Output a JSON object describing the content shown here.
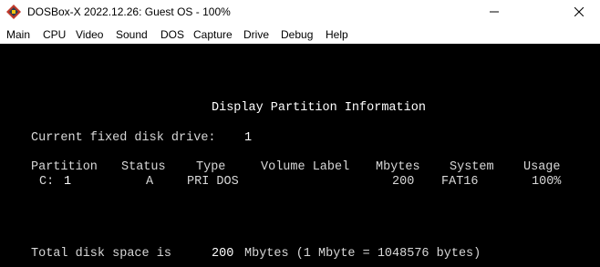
{
  "window": {
    "title": "DOSBox-X 2022.12.26: Guest OS - 100%"
  },
  "menu": [
    {
      "label": "Main"
    },
    {
      "label": "CPU"
    },
    {
      "label": "Video"
    },
    {
      "label": "Sound"
    },
    {
      "label": "DOS"
    },
    {
      "label": "Capture"
    },
    {
      "label": "Drive"
    },
    {
      "label": "Debug"
    },
    {
      "label": "Help"
    }
  ],
  "dos": {
    "heading": "Display Partition Information",
    "current_drive_label": "Current fixed disk drive:",
    "current_drive_value": "1",
    "table": {
      "headers": {
        "partition": "Partition",
        "status": "Status",
        "type": "Type",
        "volume_label": "Volume Label",
        "mbytes": "Mbytes",
        "system": "System",
        "usage": "Usage"
      },
      "rows": [
        {
          "drive": "C:",
          "partition": "1",
          "status": "A",
          "type": "PRI DOS",
          "volume_label": "",
          "mbytes": "200",
          "system": "FAT16",
          "usage": "100%"
        }
      ]
    },
    "total_label": "Total disk space is",
    "total_value": "200",
    "total_suffix": "Mbytes (1 Mbyte = 1048576 bytes)"
  },
  "icons": {
    "app": "dosbox-app-icon",
    "minimize": "minimize-icon",
    "close": "close-icon"
  },
  "colors": {
    "screen_background": "#000000",
    "screen_text": "#d8d8d8",
    "screen_highlight": "#ffffff"
  }
}
